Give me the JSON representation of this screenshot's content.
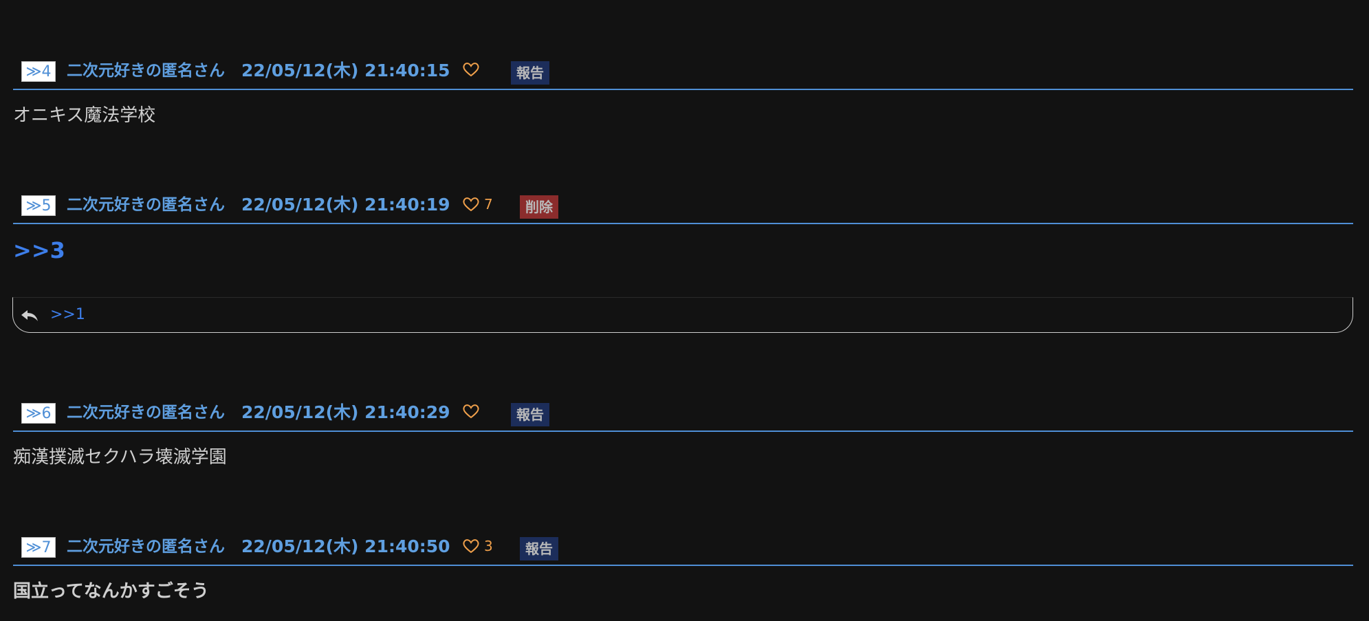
{
  "posts": [
    {
      "num_label": "≫4",
      "author": "二次元好きの匿名さん",
      "timestamp": "22/05/12(木) 21:40:15",
      "likes": "",
      "action": "報告",
      "body": "オニキス魔法学校"
    },
    {
      "num_label": "≫5",
      "author": "二次元好きの匿名さん",
      "timestamp": "22/05/12(木) 21:40:19",
      "likes": "7",
      "action": "削除",
      "body": ">>3",
      "reply_link": ">>1"
    },
    {
      "num_label": "≫6",
      "author": "二次元好きの匿名さん",
      "timestamp": "22/05/12(木) 21:40:29",
      "likes": "",
      "action": "報告",
      "body": "痴漢撲滅セクハラ壊滅学園"
    },
    {
      "num_label": "≫7",
      "author": "二次元好きの匿名さん",
      "timestamp": "22/05/12(木) 21:40:50",
      "likes": "3",
      "action": "報告",
      "body": "国立ってなんかすごそう"
    }
  ],
  "colors": {
    "background": "#121212",
    "accent": "#5f9fe0",
    "like": "#f0a04b",
    "report_badge": "#1c2d5a",
    "delete_badge": "#8b2c2c"
  },
  "icons": {
    "like": "heart-outline-icon",
    "reply": "reply-arrow-icon"
  }
}
